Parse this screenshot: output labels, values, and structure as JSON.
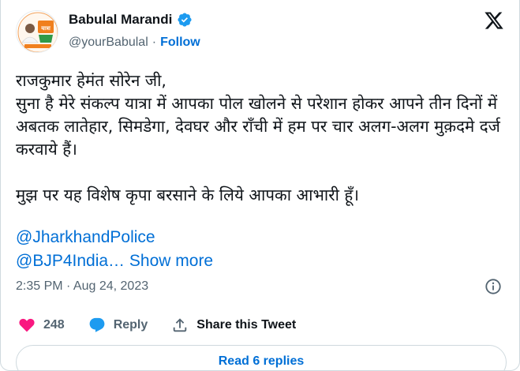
{
  "author": {
    "name": "Babulal Marandi",
    "handle": "@yourBabulal",
    "separator": "·",
    "follow_label": "Follow",
    "avatar_icon": "profile-photo-icon",
    "verified_icon": "verified-badge-icon"
  },
  "logo_icon": "x-logo-icon",
  "tweet": {
    "text": "राजकुमार हेमंत सोरेन जी,\nसुना है मेरे संकल्प यात्रा में आपका पोल खोलने से परेशान होकर आपने तीन दिनों में अबतक लातेहार, सिमडेगा, देवघर और राँची में हम पर चार अलग-अलग मुक़दमे दर्ज करवाये हैं।\n\nमुझ पर यह विशेष कृपा बरसाने के लिये आपका आभारी हूँ।",
    "mention_1": "@JharkhandPolice",
    "mention_2": "@BJP4India…",
    "show_more": "Show more",
    "timestamp": "2:35 PM · Aug 24, 2023",
    "info_icon": "info-icon"
  },
  "actions": {
    "like_count": "248",
    "reply_label": "Reply",
    "share_label": "Share this Tweet",
    "like_icon": "heart-icon",
    "reply_icon": "reply-bubble-icon",
    "share_icon": "share-icon"
  },
  "read_replies_label": "Read 6 replies",
  "colors": {
    "link": "#006fd6",
    "like": "#f91880",
    "reply": "#1d9bf0",
    "verified": "#1d9bf0",
    "muted": "#536471",
    "text": "#0f1419"
  }
}
